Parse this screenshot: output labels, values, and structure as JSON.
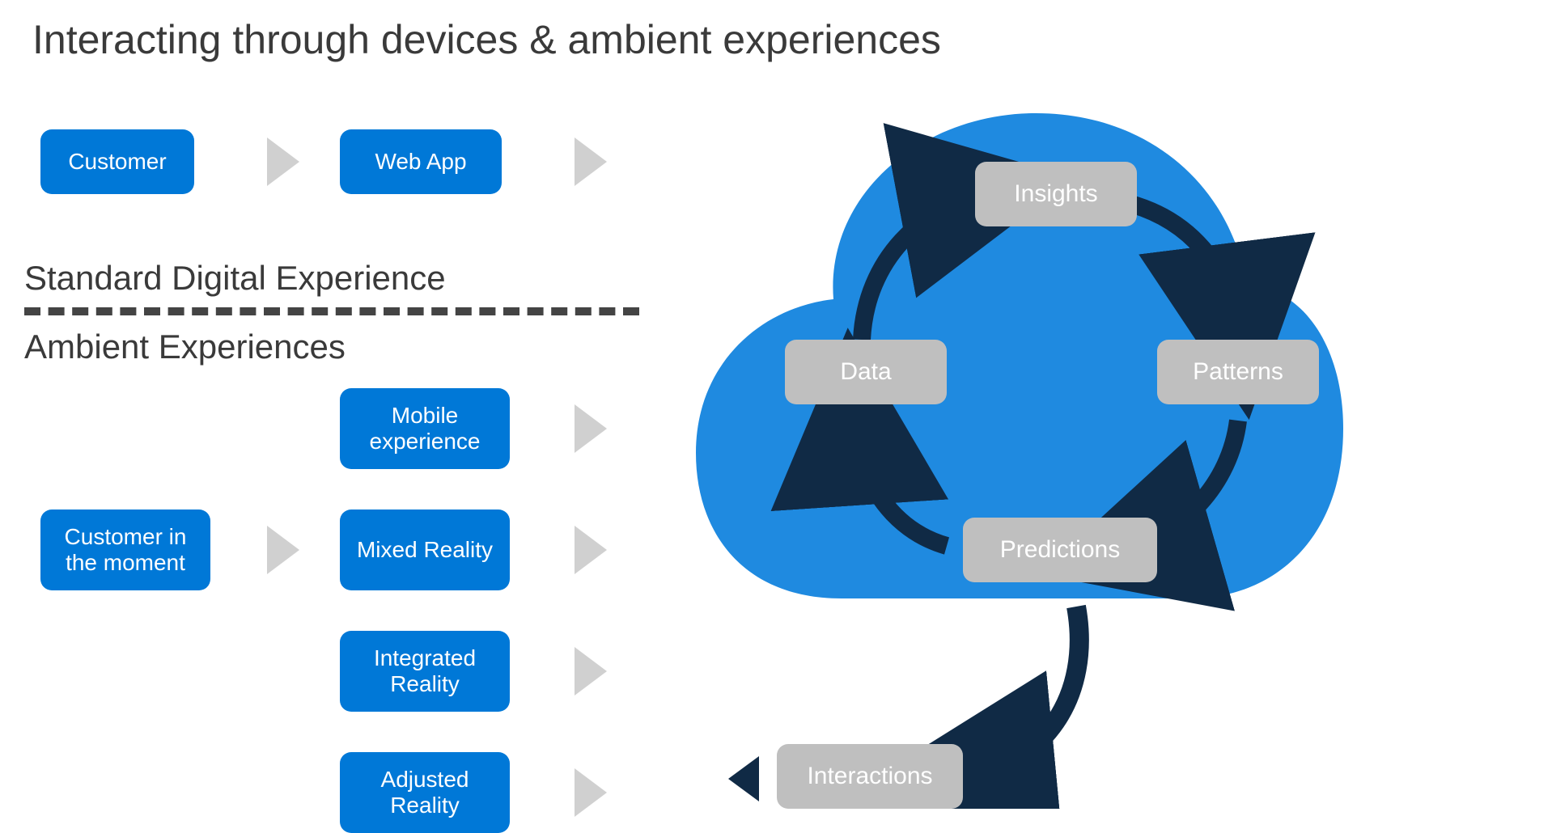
{
  "title": "Interacting through devices & ambient experiences",
  "sections": {
    "standard": "Standard Digital Experience",
    "ambient": "Ambient Experiences"
  },
  "flow_top": {
    "customer": "Customer",
    "webapp": "Web App"
  },
  "flow_bottom": {
    "customer_moment": "Customer in the moment",
    "experiences": [
      "Mobile experience",
      "Mixed Reality",
      "Integrated Reality",
      "Adjusted Reality"
    ]
  },
  "cloud_cycle": {
    "insights": "Insights",
    "patterns": "Patterns",
    "predictions": "Predictions",
    "data": "Data"
  },
  "interactions": "Interactions",
  "colors": {
    "blue": "#0078d7",
    "gray_box": "#bfbfbf",
    "dark_arrow": "#102a45",
    "chevron": "#d0d0d0",
    "cloud": "#1f8ae0"
  }
}
